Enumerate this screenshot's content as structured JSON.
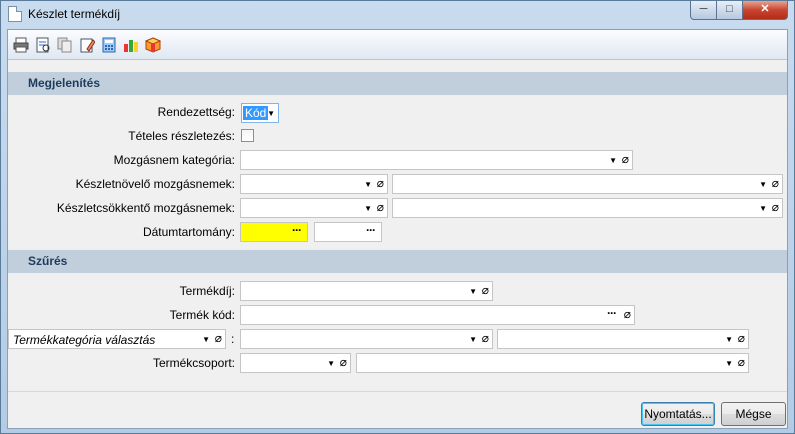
{
  "window": {
    "title": "Készlet termékdíj"
  },
  "toolbar": {
    "icons": [
      "print-icon",
      "preview-icon",
      "copy-icon",
      "edit-icon",
      "calculator-icon",
      "chart-icon",
      "package-icon"
    ]
  },
  "display_section": {
    "title": "Megjelenítés",
    "order_label": "Rendezettség:",
    "order_value": "Kód",
    "itemized_label": "Tételes részletezés:",
    "movement_category_label": "Mozgásnem kategória:",
    "stock_increase_label": "Készletnövelő mozgásnemek:",
    "stock_decrease_label": "Készletcsökkentő mozgásnemek:",
    "date_range_label": "Dátumtartomány:"
  },
  "filter_section": {
    "title": "Szűrés",
    "fee_label": "Termékdíj:",
    "product_code_label": "Termék kód:",
    "category_select_value": "Termékkategória választás",
    "category_colon": ":",
    "product_group_label": "Termékcsoport:"
  },
  "buttons": {
    "print": "Nyomtatás...",
    "cancel": "Mégse"
  },
  "glyphs": {
    "dropdown": "▼",
    "clip": "⌀",
    "dots": "···",
    "minimize": "─",
    "maximize": "□",
    "close": "✕"
  },
  "colors": {
    "date_highlight": "#ffff00",
    "selection": "#3399ff",
    "section_bg": "#c1cfdd"
  }
}
